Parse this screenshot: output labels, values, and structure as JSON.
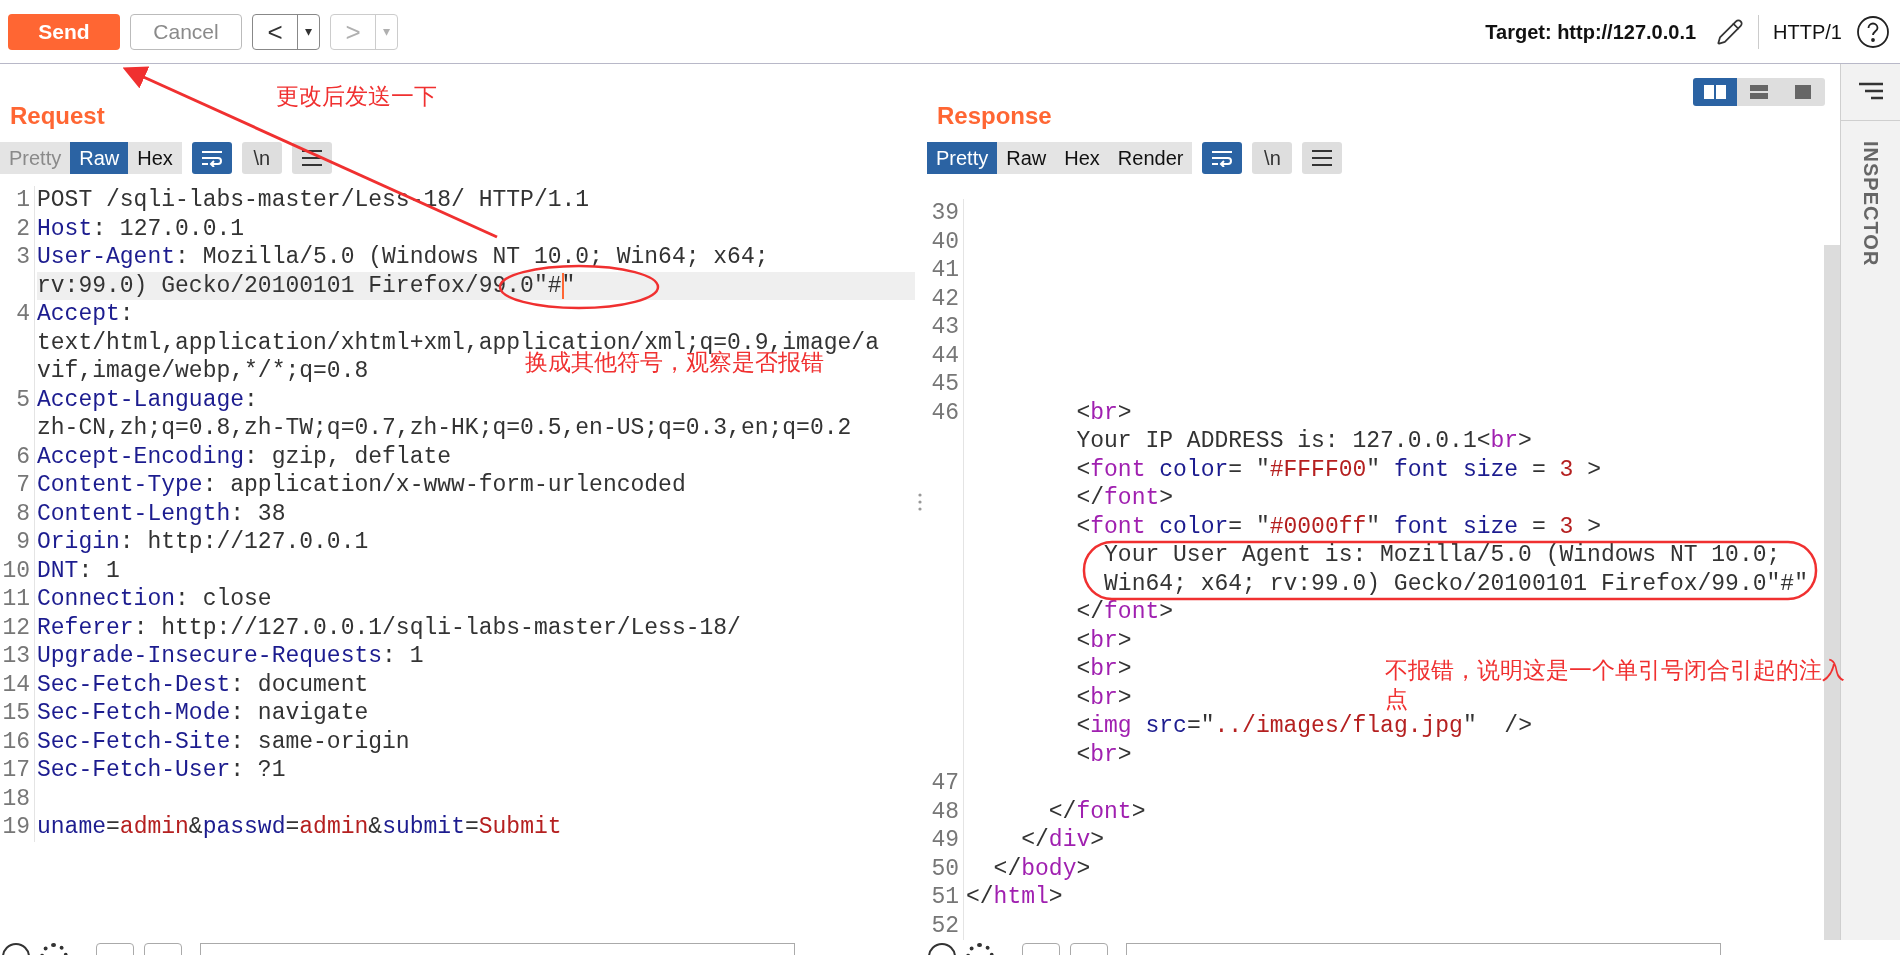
{
  "toolbar": {
    "buttons": [
      {
        "kind": "send",
        "label": "Send",
        "disabled": false
      },
      {
        "kind": "cancel",
        "label": "Cancel",
        "disabled": true
      }
    ],
    "nav": [
      {
        "label": "<",
        "menu": "▾",
        "disabled": false
      },
      {
        "label": ">",
        "menu": "▾",
        "disabled": true
      }
    ],
    "target": "Target: http://127.0.0.1",
    "protocol": "HTTP/1"
  },
  "request": {
    "title": "Request",
    "tabs": [
      {
        "label": "Pretty",
        "selected": false,
        "disabled": true
      },
      {
        "label": "Raw",
        "selected": true,
        "disabled": false
      },
      {
        "label": "Hex",
        "selected": false,
        "disabled": false
      }
    ],
    "toggles": [
      {
        "kind": "wrap",
        "on": true
      },
      {
        "kind": "newline",
        "label": "\\n",
        "on": false
      },
      {
        "kind": "menu",
        "on": false
      }
    ],
    "lines": [
      {
        "number": "1",
        "current": false,
        "rows": [
          {
            "parts": [
              {
                "kind": "plain",
                "text": "POST /sqli-labs-master/Less-18/ HTTP/1.1"
              }
            ]
          }
        ]
      },
      {
        "number": "2",
        "current": false,
        "rows": [
          {
            "parts": [
              {
                "kind": "name",
                "text": "Host"
              },
              {
                "kind": "plain",
                "text": ": 127.0.0.1"
              }
            ]
          }
        ]
      },
      {
        "number": "3",
        "current": true,
        "rows": [
          {
            "parts": [
              {
                "kind": "name",
                "text": "User-Agent"
              },
              {
                "kind": "plain",
                "text": ": Mozilla/5.0 (Windows NT 10.0; Win64; x64;"
              }
            ]
          },
          {
            "parts": [
              {
                "kind": "plain",
                "text": "rv:99.0) Gecko/20100101 Firefox/99.0\"#"
              },
              {
                "kind": "plain",
                "text": "\"",
                "caret": true
              }
            ]
          }
        ]
      },
      {
        "number": "4",
        "current": false,
        "rows": [
          {
            "parts": [
              {
                "kind": "name",
                "text": "Accept"
              },
              {
                "kind": "plain",
                "text": ":"
              }
            ]
          },
          {
            "parts": [
              {
                "kind": "plain",
                "text": "text/html,application/xhtml+xml,application/xml;q=0.9,image/a"
              }
            ]
          },
          {
            "parts": [
              {
                "kind": "plain",
                "text": "vif,image/webp,*/*;q=0.8"
              }
            ]
          }
        ]
      },
      {
        "number": "5",
        "current": false,
        "rows": [
          {
            "parts": [
              {
                "kind": "name",
                "text": "Accept-Language"
              },
              {
                "kind": "plain",
                "text": ":"
              }
            ]
          },
          {
            "parts": [
              {
                "kind": "plain",
                "text": "zh-CN,zh;q=0.8,zh-TW;q=0.7,zh-HK;q=0.5,en-US;q=0.3,en;q=0.2"
              }
            ]
          }
        ]
      },
      {
        "number": "6",
        "current": false,
        "rows": [
          {
            "parts": [
              {
                "kind": "name",
                "text": "Accept-Encoding"
              },
              {
                "kind": "plain",
                "text": ": gzip, deflate"
              }
            ]
          }
        ]
      },
      {
        "number": "7",
        "current": false,
        "rows": [
          {
            "parts": [
              {
                "kind": "name",
                "text": "Content-Type"
              },
              {
                "kind": "plain",
                "text": ": application/x-www-form-urlencoded"
              }
            ]
          }
        ]
      },
      {
        "number": "8",
        "current": false,
        "rows": [
          {
            "parts": [
              {
                "kind": "name",
                "text": "Content-Length"
              },
              {
                "kind": "plain",
                "text": ": 38"
              }
            ]
          }
        ]
      },
      {
        "number": "9",
        "current": false,
        "rows": [
          {
            "parts": [
              {
                "kind": "name",
                "text": "Origin"
              },
              {
                "kind": "plain",
                "text": ": http://127.0.0.1"
              }
            ]
          }
        ]
      },
      {
        "number": "10",
        "current": false,
        "rows": [
          {
            "parts": [
              {
                "kind": "name",
                "text": "DNT"
              },
              {
                "kind": "plain",
                "text": ": 1"
              }
            ]
          }
        ]
      },
      {
        "number": "11",
        "current": false,
        "rows": [
          {
            "parts": [
              {
                "kind": "name",
                "text": "Connection"
              },
              {
                "kind": "plain",
                "text": ": close"
              }
            ]
          }
        ]
      },
      {
        "number": "12",
        "current": false,
        "rows": [
          {
            "parts": [
              {
                "kind": "name",
                "text": "Referer"
              },
              {
                "kind": "plain",
                "text": ": http://127.0.0.1/sqli-labs-master/Less-18/"
              }
            ]
          }
        ]
      },
      {
        "number": "13",
        "current": false,
        "rows": [
          {
            "parts": [
              {
                "kind": "name",
                "text": "Upgrade-Insecure-Requests"
              },
              {
                "kind": "plain",
                "text": ": 1"
              }
            ]
          }
        ]
      },
      {
        "number": "14",
        "current": false,
        "rows": [
          {
            "parts": [
              {
                "kind": "name",
                "text": "Sec-Fetch-Dest"
              },
              {
                "kind": "plain",
                "text": ": document"
              }
            ]
          }
        ]
      },
      {
        "number": "15",
        "current": false,
        "rows": [
          {
            "parts": [
              {
                "kind": "name",
                "text": "Sec-Fetch-Mode"
              },
              {
                "kind": "plain",
                "text": ": navigate"
              }
            ]
          }
        ]
      },
      {
        "number": "16",
        "current": false,
        "rows": [
          {
            "parts": [
              {
                "kind": "name",
                "text": "Sec-Fetch-Site"
              },
              {
                "kind": "plain",
                "text": ": same-origin"
              }
            ]
          }
        ]
      },
      {
        "number": "17",
        "current": false,
        "rows": [
          {
            "parts": [
              {
                "kind": "name",
                "text": "Sec-Fetch-User"
              },
              {
                "kind": "plain",
                "text": ": ?1"
              }
            ]
          }
        ]
      },
      {
        "number": "18",
        "current": false
      },
      {
        "number": "19",
        "current": false,
        "rows": [
          {
            "parts": [
              {
                "kind": "name",
                "text": "uname"
              },
              {
                "kind": "plain",
                "text": "="
              },
              {
                "kind": "value",
                "text": "admin"
              },
              {
                "kind": "plain",
                "text": "&"
              },
              {
                "kind": "name",
                "text": "passwd"
              },
              {
                "kind": "plain",
                "text": "="
              },
              {
                "kind": "value",
                "text": "admin"
              },
              {
                "kind": "plain",
                "text": "&"
              },
              {
                "kind": "name",
                "text": "submit"
              },
              {
                "kind": "plain",
                "text": "="
              },
              {
                "kind": "value",
                "text": "Submit"
              }
            ]
          }
        ]
      }
    ]
  },
  "response": {
    "title": "Response",
    "layouts": [
      {
        "kind": "split",
        "selected": true
      },
      {
        "kind": "stacked",
        "selected": false
      },
      {
        "kind": "single",
        "selected": false
      }
    ],
    "tabs": [
      {
        "label": "Pretty",
        "selected": true,
        "disabled": false
      },
      {
        "label": "Raw",
        "selected": false,
        "disabled": false
      },
      {
        "label": "Hex",
        "selected": false,
        "disabled": false
      },
      {
        "label": "Render",
        "selected": false,
        "disabled": false
      }
    ],
    "toggles": [
      {
        "kind": "wrap",
        "on": true
      },
      {
        "kind": "newline",
        "label": "\\n",
        "on": false
      },
      {
        "kind": "menu",
        "on": false
      }
    ],
    "lines": [
      {
        "number": "39",
        "current": false
      },
      {
        "number": "40",
        "current": false
      },
      {
        "number": "41",
        "current": false
      },
      {
        "number": "42",
        "current": false
      },
      {
        "number": "43",
        "current": false
      },
      {
        "number": "44",
        "current": false
      },
      {
        "number": "45",
        "current": false
      },
      {
        "number": "46",
        "current": false,
        "rows": [
          {
            "parts": [
              {
                "kind": "plain",
                "text": "        <"
              },
              {
                "kind": "tag",
                "text": "br"
              },
              {
                "kind": "plain",
                "text": ">"
              }
            ]
          },
          {
            "parts": [
              {
                "kind": "plain",
                "text": "        Your IP ADDRESS is: 127.0.0.1<"
              },
              {
                "kind": "tag",
                "text": "br"
              },
              {
                "kind": "plain",
                "text": ">"
              }
            ]
          },
          {
            "parts": [
              {
                "kind": "plain",
                "text": "        <"
              },
              {
                "kind": "tag",
                "text": "font"
              },
              {
                "kind": "name",
                "text": " color"
              },
              {
                "kind": "plain",
                "text": "= \""
              },
              {
                "kind": "value",
                "text": "#FFFF00"
              },
              {
                "kind": "plain",
                "text": "\""
              },
              {
                "kind": "name",
                "text": " font size"
              },
              {
                "kind": "plain",
                "text": " = "
              },
              {
                "kind": "value",
                "text": "3"
              },
              {
                "kind": "plain",
                "text": " >"
              }
            ]
          },
          {
            "parts": [
              {
                "kind": "plain",
                "text": "        </"
              },
              {
                "kind": "tag",
                "text": "font"
              },
              {
                "kind": "plain",
                "text": ">"
              }
            ]
          },
          {
            "parts": [
              {
                "kind": "plain",
                "text": "        <"
              },
              {
                "kind": "tag",
                "text": "font"
              },
              {
                "kind": "name",
                "text": " color"
              },
              {
                "kind": "plain",
                "text": "= \""
              },
              {
                "kind": "value",
                "text": "#0000ff"
              },
              {
                "kind": "plain",
                "text": "\""
              },
              {
                "kind": "name",
                "text": " font size"
              },
              {
                "kind": "plain",
                "text": " = "
              },
              {
                "kind": "value",
                "text": "3"
              },
              {
                "kind": "plain",
                "text": " >"
              }
            ]
          },
          {
            "parts": [
              {
                "kind": "plain",
                "text": "          Your User Agent is: Mozilla/5.0 (Windows NT 10.0;"
              }
            ]
          },
          {
            "parts": [
              {
                "kind": "plain",
                "text": "          Win64; x64; rv:99.0) Gecko/20100101 Firefox/99.0\"#\""
              }
            ]
          },
          {
            "parts": [
              {
                "kind": "plain",
                "text": "        </"
              },
              {
                "kind": "tag",
                "text": "font"
              },
              {
                "kind": "plain",
                "text": ">"
              }
            ]
          },
          {
            "parts": [
              {
                "kind": "plain",
                "text": "        <"
              },
              {
                "kind": "tag",
                "text": "br"
              },
              {
                "kind": "plain",
                "text": ">"
              }
            ]
          },
          {
            "parts": [
              {
                "kind": "plain",
                "text": "        <"
              },
              {
                "kind": "tag",
                "text": "br"
              },
              {
                "kind": "plain",
                "text": ">"
              }
            ]
          },
          {
            "parts": [
              {
                "kind": "plain",
                "text": "        <"
              },
              {
                "kind": "tag",
                "text": "br"
              },
              {
                "kind": "plain",
                "text": ">"
              }
            ]
          },
          {
            "parts": [
              {
                "kind": "plain",
                "text": "        <"
              },
              {
                "kind": "tag",
                "text": "img"
              },
              {
                "kind": "name",
                "text": " src"
              },
              {
                "kind": "plain",
                "text": "=\""
              },
              {
                "kind": "value",
                "text": "../images/flag.jpg"
              },
              {
                "kind": "plain",
                "text": "\"  />"
              }
            ]
          },
          {
            "parts": [
              {
                "kind": "plain",
                "text": "        <"
              },
              {
                "kind": "tag",
                "text": "br"
              },
              {
                "kind": "plain",
                "text": ">"
              }
            ]
          }
        ]
      },
      {
        "number": "47",
        "current": false
      },
      {
        "number": "48",
        "current": false,
        "rows": [
          {
            "parts": [
              {
                "kind": "plain",
                "text": "      </"
              },
              {
                "kind": "tag",
                "text": "font"
              },
              {
                "kind": "plain",
                "text": ">"
              }
            ]
          }
        ]
      },
      {
        "number": "49",
        "current": false,
        "rows": [
          {
            "parts": [
              {
                "kind": "plain",
                "text": "    </"
              },
              {
                "kind": "tag",
                "text": "div"
              },
              {
                "kind": "plain",
                "text": ">"
              }
            ]
          }
        ]
      },
      {
        "number": "50",
        "current": false,
        "rows": [
          {
            "parts": [
              {
                "kind": "plain",
                "text": "  </"
              },
              {
                "kind": "tag",
                "text": "body"
              },
              {
                "kind": "plain",
                "text": ">"
              }
            ]
          }
        ]
      },
      {
        "number": "51",
        "current": false,
        "rows": [
          {
            "parts": [
              {
                "kind": "plain",
                "text": "</"
              },
              {
                "kind": "tag",
                "text": "html"
              },
              {
                "kind": "plain",
                "text": ">"
              }
            ]
          }
        ]
      },
      {
        "number": "52",
        "current": false
      }
    ]
  },
  "inspector": {
    "label": "INSPECTOR"
  },
  "annotations": [
    "更改后发送一下",
    "换成其他符号，观察是否报错",
    "不报错，说明这是一个单引号闭合引起的注入点"
  ]
}
